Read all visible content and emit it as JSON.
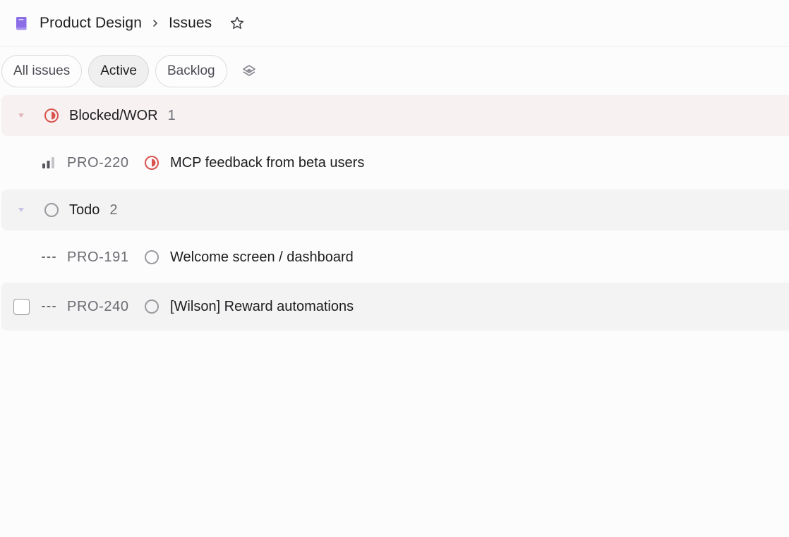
{
  "breadcrumb": {
    "project": "Product Design",
    "page": "Issues",
    "project_icon": "book-icon",
    "project_icon_color": "#8b6ee6"
  },
  "tabs": [
    {
      "label": "All issues",
      "active": false
    },
    {
      "label": "Active",
      "active": true
    },
    {
      "label": "Backlog",
      "active": false
    }
  ],
  "groups": [
    {
      "name": "Blocked/WOR",
      "count": "1",
      "status_icon": "blocked-status-icon",
      "color": "#d9534f",
      "issues": [
        {
          "id": "PRO-220",
          "title": "MCP feedback from beta users",
          "priority_icon": "priority-medium-icon",
          "status_icon": "blocked-status-icon"
        }
      ]
    },
    {
      "name": "Todo",
      "count": "2",
      "status_icon": "todo-status-icon",
      "color": "#9a9aa0",
      "issues": [
        {
          "id": "PRO-191",
          "title": "Welcome screen / dashboard",
          "priority_icon": "no-priority-icon",
          "status_icon": "todo-status-icon"
        },
        {
          "id": "PRO-240",
          "title": "[Wilson] Reward automations",
          "priority_icon": "no-priority-icon",
          "status_icon": "todo-status-icon"
        }
      ]
    }
  ]
}
